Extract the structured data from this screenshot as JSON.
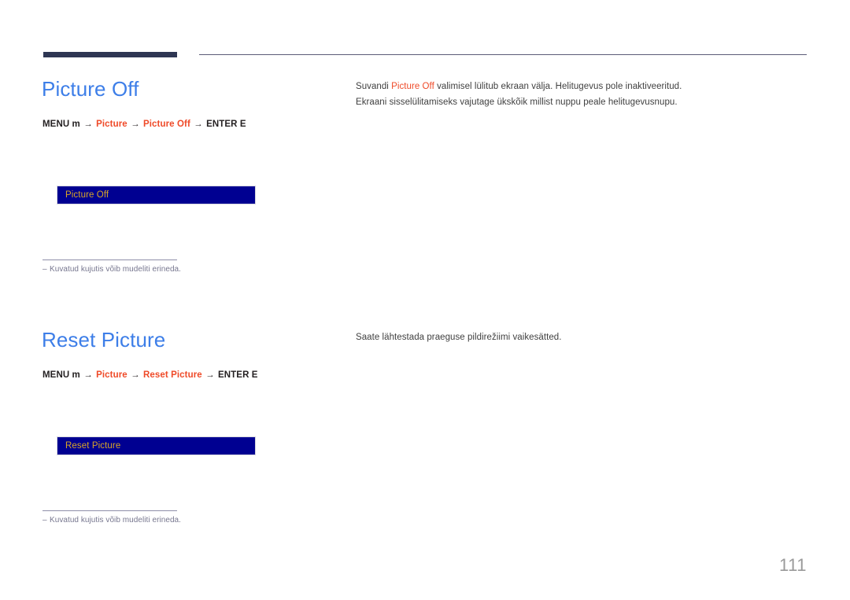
{
  "document": {
    "page_number": "111"
  },
  "colors": {
    "heading_blue": "#3d7ee8",
    "accent_orange": "#ef4a28",
    "osd_background": "#000091",
    "osd_label": "#d9a528",
    "rule_navy": "#2e3653",
    "footnote_gray": "#77778f",
    "page_number_gray": "#9a9a9a"
  },
  "sections": [
    {
      "heading": "Picture Off",
      "menu_path": {
        "prefix": "MENU m",
        "arrow": "→",
        "step1": "Picture",
        "step2": "Picture Off",
        "suffix": "ENTER E"
      },
      "osd": {
        "label": "Picture Off"
      },
      "body": {
        "line1_before": "Suvandi ",
        "line1_accent": "Picture Off",
        "line1_after": " valimisel lülitub ekraan välja. Helitugevus pole inaktiveeritud.",
        "line2": "Ekraani sisselülitamiseks vajutage ükskõik millist nuppu peale helitugevusnupu."
      },
      "footnote": {
        "dash": "–",
        "text": "Kuvatud kujutis võib mudeliti erineda."
      }
    },
    {
      "heading": "Reset Picture",
      "menu_path": {
        "prefix": "MENU m",
        "arrow": "→",
        "step1": "Picture",
        "step2": "Reset Picture",
        "suffix": "ENTER E"
      },
      "osd": {
        "label": "Reset Picture"
      },
      "body": {
        "line1_before": "",
        "line1_accent": "",
        "line1_after": "Saate lähtestada praeguse pildirežiimi vaikesätted.",
        "line2": ""
      },
      "footnote": {
        "dash": "–",
        "text": "Kuvatud kujutis võib mudeliti erineda."
      }
    }
  ]
}
